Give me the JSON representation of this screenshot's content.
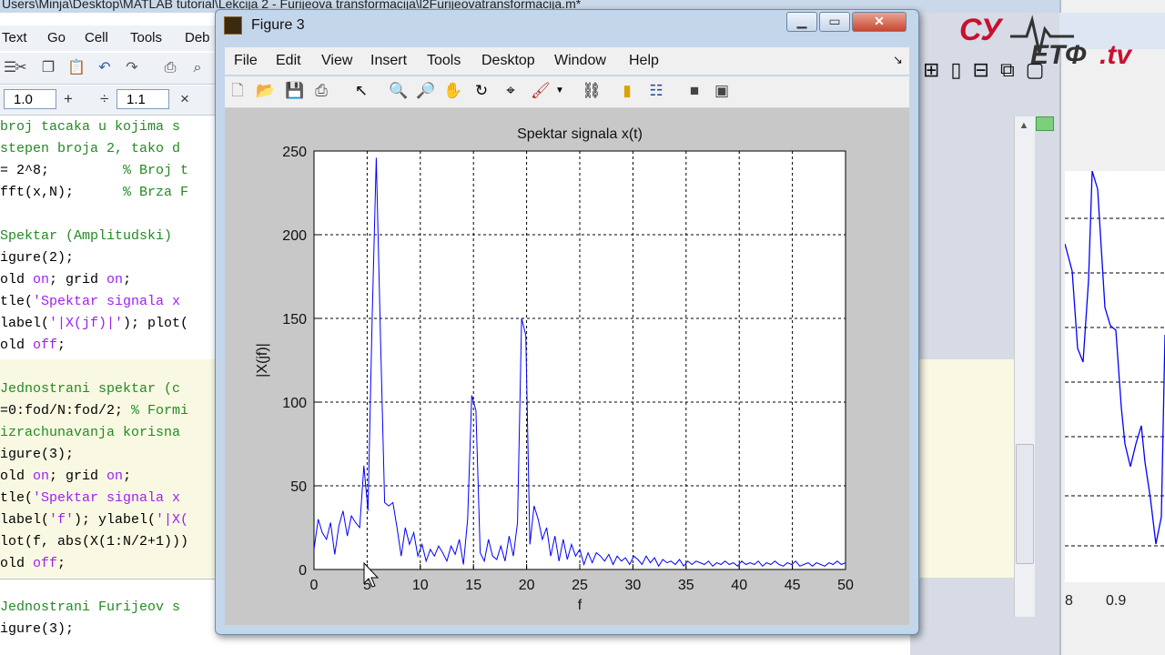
{
  "editor": {
    "title_text": "Users\\Minja\\Desktop\\MATLAB tutorial\\Lekcija 2 - Furijeova transformacija\\l2Furijeovatransformacija.m*",
    "menu": [
      "Text",
      "Go",
      "Cell",
      "Tools",
      "Deb"
    ],
    "cell_value_1": "1.0",
    "cell_value_2": "1.1",
    "cell_ops": [
      "+",
      "÷",
      "×"
    ],
    "code_lines": [
      {
        "parts": [
          {
            "t": "broj tacaka u kojima s",
            "c": "g"
          }
        ]
      },
      {
        "parts": [
          {
            "t": "stepen broja 2, tako d",
            "c": "g"
          }
        ]
      },
      {
        "parts": [
          {
            "t": "= 2^8;         ",
            "c": ""
          },
          {
            "t": "% Broj t",
            "c": "g"
          }
        ]
      },
      {
        "parts": [
          {
            "t": "fft(x,N);      ",
            "c": ""
          },
          {
            "t": "% Brza F",
            "c": "g"
          }
        ]
      },
      {
        "parts": [
          {
            "t": "",
            "c": ""
          }
        ]
      },
      {
        "parts": [
          {
            "t": "Spektar (Amplitudski)",
            "c": "g"
          }
        ]
      },
      {
        "parts": [
          {
            "t": "igure(2);",
            "c": ""
          }
        ]
      },
      {
        "parts": [
          {
            "t": "old ",
            "c": ""
          },
          {
            "t": "on",
            "c": "p"
          },
          {
            "t": "; grid ",
            "c": ""
          },
          {
            "t": "on",
            "c": "p"
          },
          {
            "t": ";",
            "c": ""
          }
        ]
      },
      {
        "parts": [
          {
            "t": "tle(",
            "c": ""
          },
          {
            "t": "'Spektar signala x",
            "c": "p"
          }
        ]
      },
      {
        "parts": [
          {
            "t": "label(",
            "c": ""
          },
          {
            "t": "'|X(jf)|'",
            "c": "p"
          },
          {
            "t": "); plot(",
            "c": ""
          }
        ]
      },
      {
        "parts": [
          {
            "t": "old ",
            "c": ""
          },
          {
            "t": "off",
            "c": "p"
          },
          {
            "t": ";",
            "c": ""
          }
        ]
      },
      {
        "parts": [
          {
            "t": "",
            "c": ""
          }
        ]
      },
      {
        "parts": [
          {
            "t": "Jednostrani spektar (c",
            "c": "g"
          }
        ]
      },
      {
        "parts": [
          {
            "t": "=0:fod/N:fod/2; ",
            "c": ""
          },
          {
            "t": "% Formi",
            "c": "g"
          }
        ]
      },
      {
        "parts": [
          {
            "t": "izrachunavanja korisna",
            "c": "g"
          }
        ]
      },
      {
        "parts": [
          {
            "t": "igure(3);",
            "c": ""
          }
        ]
      },
      {
        "parts": [
          {
            "t": "old ",
            "c": ""
          },
          {
            "t": "on",
            "c": "p"
          },
          {
            "t": "; grid ",
            "c": ""
          },
          {
            "t": "on",
            "c": "p"
          },
          {
            "t": ";",
            "c": ""
          }
        ]
      },
      {
        "parts": [
          {
            "t": "tle(",
            "c": ""
          },
          {
            "t": "'Spektar signala x",
            "c": "p"
          }
        ]
      },
      {
        "parts": [
          {
            "t": "label(",
            "c": ""
          },
          {
            "t": "'f'",
            "c": "p"
          },
          {
            "t": "); ylabel(",
            "c": ""
          },
          {
            "t": "'|X(",
            "c": "p"
          }
        ]
      },
      {
        "parts": [
          {
            "t": "lot(f, abs(X(1:N/2+1)))",
            "c": ""
          }
        ]
      },
      {
        "parts": [
          {
            "t": "old ",
            "c": ""
          },
          {
            "t": "off",
            "c": "p"
          },
          {
            "t": ";",
            "c": ""
          }
        ]
      },
      {
        "parts": [
          {
            "t": "",
            "c": ""
          }
        ]
      },
      {
        "parts": [
          {
            "t": "Jednostrani Furijeov s",
            "c": "g"
          }
        ]
      },
      {
        "parts": [
          {
            "t": "igure(3);",
            "c": ""
          }
        ]
      }
    ]
  },
  "figure": {
    "title": "Figure 3",
    "menu": [
      "File",
      "Edit",
      "View",
      "Insert",
      "Tools",
      "Desktop",
      "Window",
      "Help"
    ],
    "toolbar_icons": [
      "new-figure-icon",
      "open-file-icon",
      "save-icon",
      "print-icon",
      "edit-plot-arrow-icon",
      "zoom-in-icon",
      "zoom-out-icon",
      "pan-hand-icon",
      "rotate-3d-icon",
      "data-cursor-icon",
      "brush-icon",
      "link-plot-icon",
      "colorbar-icon",
      "legend-icon",
      "hide-plot-tools-icon",
      "show-plot-tools-icon"
    ]
  },
  "background_figure": {
    "tick_labels": [
      "8",
      "0.9"
    ]
  },
  "watermark": {
    "text": "СУ ЕТФ.tv"
  },
  "chart_data": {
    "type": "line",
    "title": "Spektar signala x(t)",
    "xlabel": "f",
    "ylabel": "|X(jf)|",
    "xlim": [
      0,
      50
    ],
    "ylim": [
      0,
      250
    ],
    "xticks": [
      0,
      5,
      10,
      15,
      20,
      25,
      30,
      35,
      40,
      45,
      50
    ],
    "yticks": [
      0,
      50,
      100,
      150,
      200,
      250
    ],
    "grid": true,
    "line_color": "#0000ff",
    "series": [
      {
        "x": [
          0,
          0.39,
          0.78,
          1.17,
          1.56,
          1.95,
          2.34,
          2.73,
          3.13,
          3.52,
          3.91,
          4.3,
          4.69,
          5.08,
          5.47,
          5.86,
          6.25,
          6.64,
          7.03,
          7.42,
          7.81,
          8.2,
          8.59,
          8.98,
          9.38,
          9.77,
          10.16,
          10.55,
          10.94,
          11.33,
          11.72,
          12.11,
          12.5,
          12.89,
          13.28,
          13.67,
          14.06,
          14.45,
          14.84,
          15.23,
          15.63,
          16.02,
          16.41,
          16.8,
          17.19,
          17.58,
          17.97,
          18.36,
          18.75,
          19.14,
          19.53,
          19.92,
          20.31,
          20.7,
          21.09,
          21.48,
          21.88,
          22.27,
          22.66,
          23.05,
          23.44,
          23.83,
          24.22,
          24.61,
          25.0,
          25.39,
          25.78,
          26.17,
          26.56,
          26.95,
          27.34,
          27.73,
          28.13,
          28.52,
          28.91,
          29.3,
          29.69,
          30.08,
          30.47,
          30.86,
          31.25,
          31.64,
          32.03,
          32.42,
          32.81,
          33.2,
          33.59,
          33.98,
          34.38,
          34.77,
          35.16,
          35.55,
          35.94,
          36.33,
          36.72,
          37.11,
          37.5,
          37.89,
          38.28,
          38.67,
          39.06,
          39.45,
          39.84,
          40.23,
          40.63,
          41.02,
          41.41,
          41.8,
          42.19,
          42.58,
          42.97,
          43.36,
          43.75,
          44.14,
          44.53,
          44.92,
          45.31,
          45.7,
          46.09,
          46.48,
          46.88,
          47.27,
          47.66,
          48.05,
          48.44,
          48.83,
          49.22,
          49.61,
          50.0
        ],
        "y": [
          12,
          30,
          22,
          18,
          28,
          9,
          26,
          35,
          20,
          32,
          28,
          25,
          62,
          35,
          150,
          246,
          140,
          40,
          38,
          40,
          25,
          8,
          25,
          15,
          22,
          8,
          15,
          5,
          12,
          8,
          14,
          10,
          5,
          14,
          9,
          18,
          3,
          30,
          104,
          95,
          10,
          5,
          18,
          8,
          6,
          14,
          5,
          20,
          8,
          28,
          150,
          140,
          15,
          38,
          30,
          18,
          25,
          8,
          20,
          5,
          18,
          6,
          15,
          8,
          12,
          3,
          10,
          4,
          10,
          8,
          5,
          9,
          3,
          8,
          5,
          7,
          3,
          8,
          6,
          3,
          8,
          4,
          7,
          2,
          6,
          4,
          5,
          3,
          6,
          2,
          5,
          3,
          5,
          4,
          3,
          5,
          2,
          4,
          3,
          5,
          3,
          4,
          2,
          5,
          3,
          4,
          3,
          5,
          2,
          4,
          3,
          5,
          3,
          2,
          4,
          3,
          5,
          2,
          3,
          4,
          2,
          4,
          3,
          2,
          4,
          3,
          5,
          3,
          4
        ]
      }
    ]
  }
}
